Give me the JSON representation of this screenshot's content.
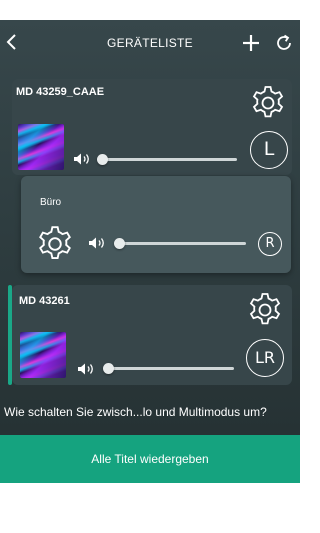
{
  "header": {
    "title": "GERÄTELISTE",
    "back_icon": "chevron-left-icon",
    "add_icon": "plus-icon",
    "refresh_icon": "refresh-icon"
  },
  "devices": [
    {
      "name": "MD 43259_CAAE",
      "channel": "L",
      "volume_fraction": 0.0,
      "settings_icon": "gear-icon",
      "speaker_icon": "speaker-icon"
    },
    {
      "name": "Büro",
      "channel": "R",
      "volume_fraction": 0.0,
      "settings_icon": "gear-icon",
      "speaker_icon": "speaker-icon"
    },
    {
      "name": "MD 43261",
      "channel": "LR",
      "volume_fraction": 0.0,
      "settings_icon": "gear-icon",
      "speaker_icon": "speaker-icon",
      "selected": true
    }
  ],
  "help_question": "Wie schalten Sie zwisch...lo und Multimodus um?",
  "play_all_label": "Alle Titel wiedergeben",
  "colors": {
    "accent": "#15a37f",
    "background": "#33424"
  }
}
